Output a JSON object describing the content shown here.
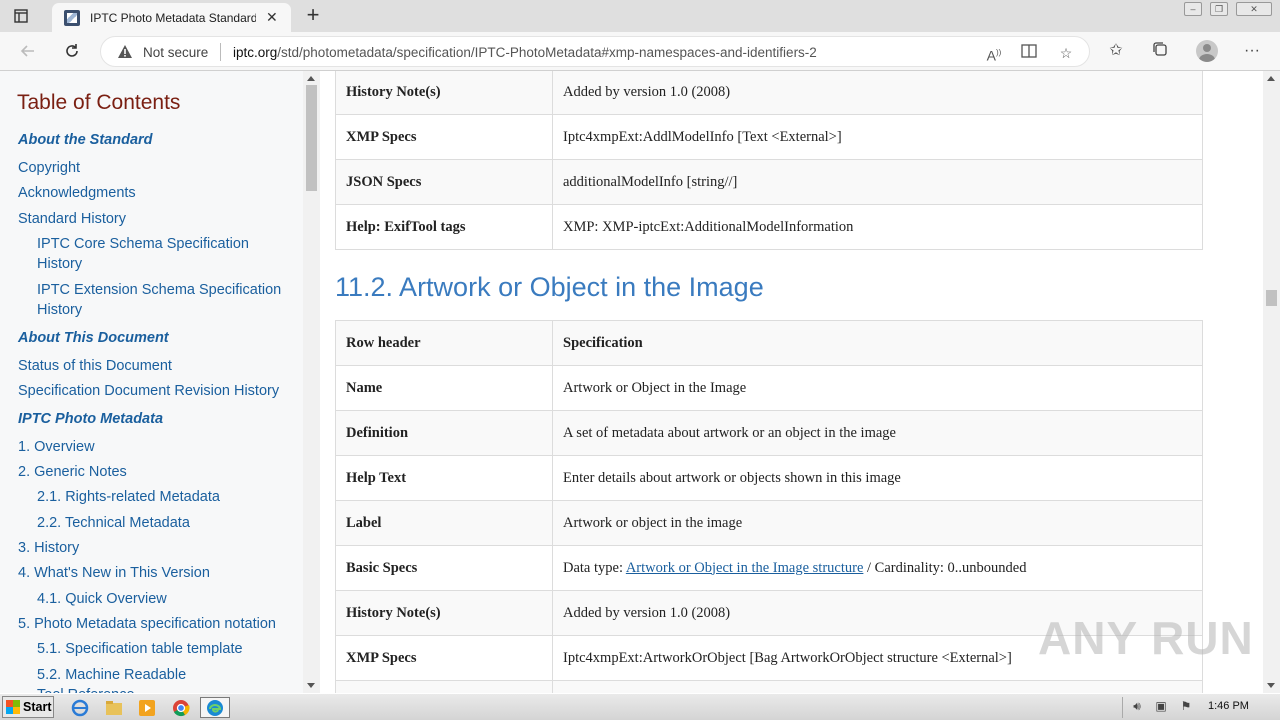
{
  "browser": {
    "tab_title": "IPTC Photo Metadata Standard",
    "tab_close": "✕",
    "new_tab": "+",
    "security_label": "Not secure",
    "url_host": "iptc.org",
    "url_path": "/std/photometadata/specification/IPTC-PhotoMetadata#xmp-namespaces-and-identifiers-2"
  },
  "toc": {
    "title": "Table of Contents",
    "items": [
      {
        "label": "About the Standard"
      },
      {
        "label": "Copyright"
      },
      {
        "label": "Acknowledgments"
      },
      {
        "label": "Standard History"
      },
      {
        "label": "IPTC Core Schema Specification"
      },
      {
        "label": "History"
      },
      {
        "label": "IPTC Extension Schema Specification"
      },
      {
        "label": "History"
      },
      {
        "label": "About This Document"
      },
      {
        "label": "Status of this Document"
      },
      {
        "label": "Specification Document Revision History"
      },
      {
        "label": "IPTC Photo Metadata"
      },
      {
        "label": "1. Overview"
      },
      {
        "label": "2. Generic Notes"
      },
      {
        "label": "2.1. Rights-related Metadata"
      },
      {
        "label": "2.2. Technical Metadata"
      },
      {
        "label": "3. History"
      },
      {
        "label": "4. What's New in This Version"
      },
      {
        "label": "4.1. Quick Overview"
      },
      {
        "label": "5. Photo Metadata specification notation"
      },
      {
        "label": "5.1. Specification table template"
      },
      {
        "label": "5.2. Machine Readable"
      },
      {
        "label": "Tool Reference"
      }
    ]
  },
  "prev_table": {
    "rows": [
      {
        "header": "History Note(s)",
        "value": "Added by version 1.0 (2008)"
      },
      {
        "header": "XMP Specs",
        "value": "Iptc4xmpExt:AddlModelInfo [Text <External>]"
      },
      {
        "header": "JSON Specs",
        "value": "additionalModelInfo [string//]"
      },
      {
        "header": "Help: ExifTool tags",
        "value": "XMP: XMP-iptcExt:AdditionalModelInformation"
      }
    ]
  },
  "section": {
    "title": "11.2. Artwork or Object in the Image"
  },
  "spec_table": {
    "rows": [
      {
        "header": "Row header",
        "value": "Specification"
      },
      {
        "header": "Name",
        "value": "Artwork or Object in the Image"
      },
      {
        "header": "Definition",
        "value": "A set of metadata about artwork or an object in the image"
      },
      {
        "header": "Help Text",
        "value": "Enter details about artwork or objects shown in this image"
      },
      {
        "header": "Label",
        "value": "Artwork or object in the image"
      },
      {
        "header": "Basic Specs",
        "value_prefix": "Data type: ",
        "link": "Artwork or Object in the Image structure",
        "value_suffix": " / Cardinality: 0..unbounded"
      },
      {
        "header": "History Note(s)",
        "value": "Added by version 1.0 (2008)"
      },
      {
        "header": "XMP Specs",
        "value": "Iptc4xmpExt:ArtworkOrObject [Bag ArtworkOrObject structure <External>]"
      }
    ]
  },
  "watermark": "ANY RUN",
  "taskbar": {
    "start_label": "Start",
    "clock": "1:46 PM"
  }
}
